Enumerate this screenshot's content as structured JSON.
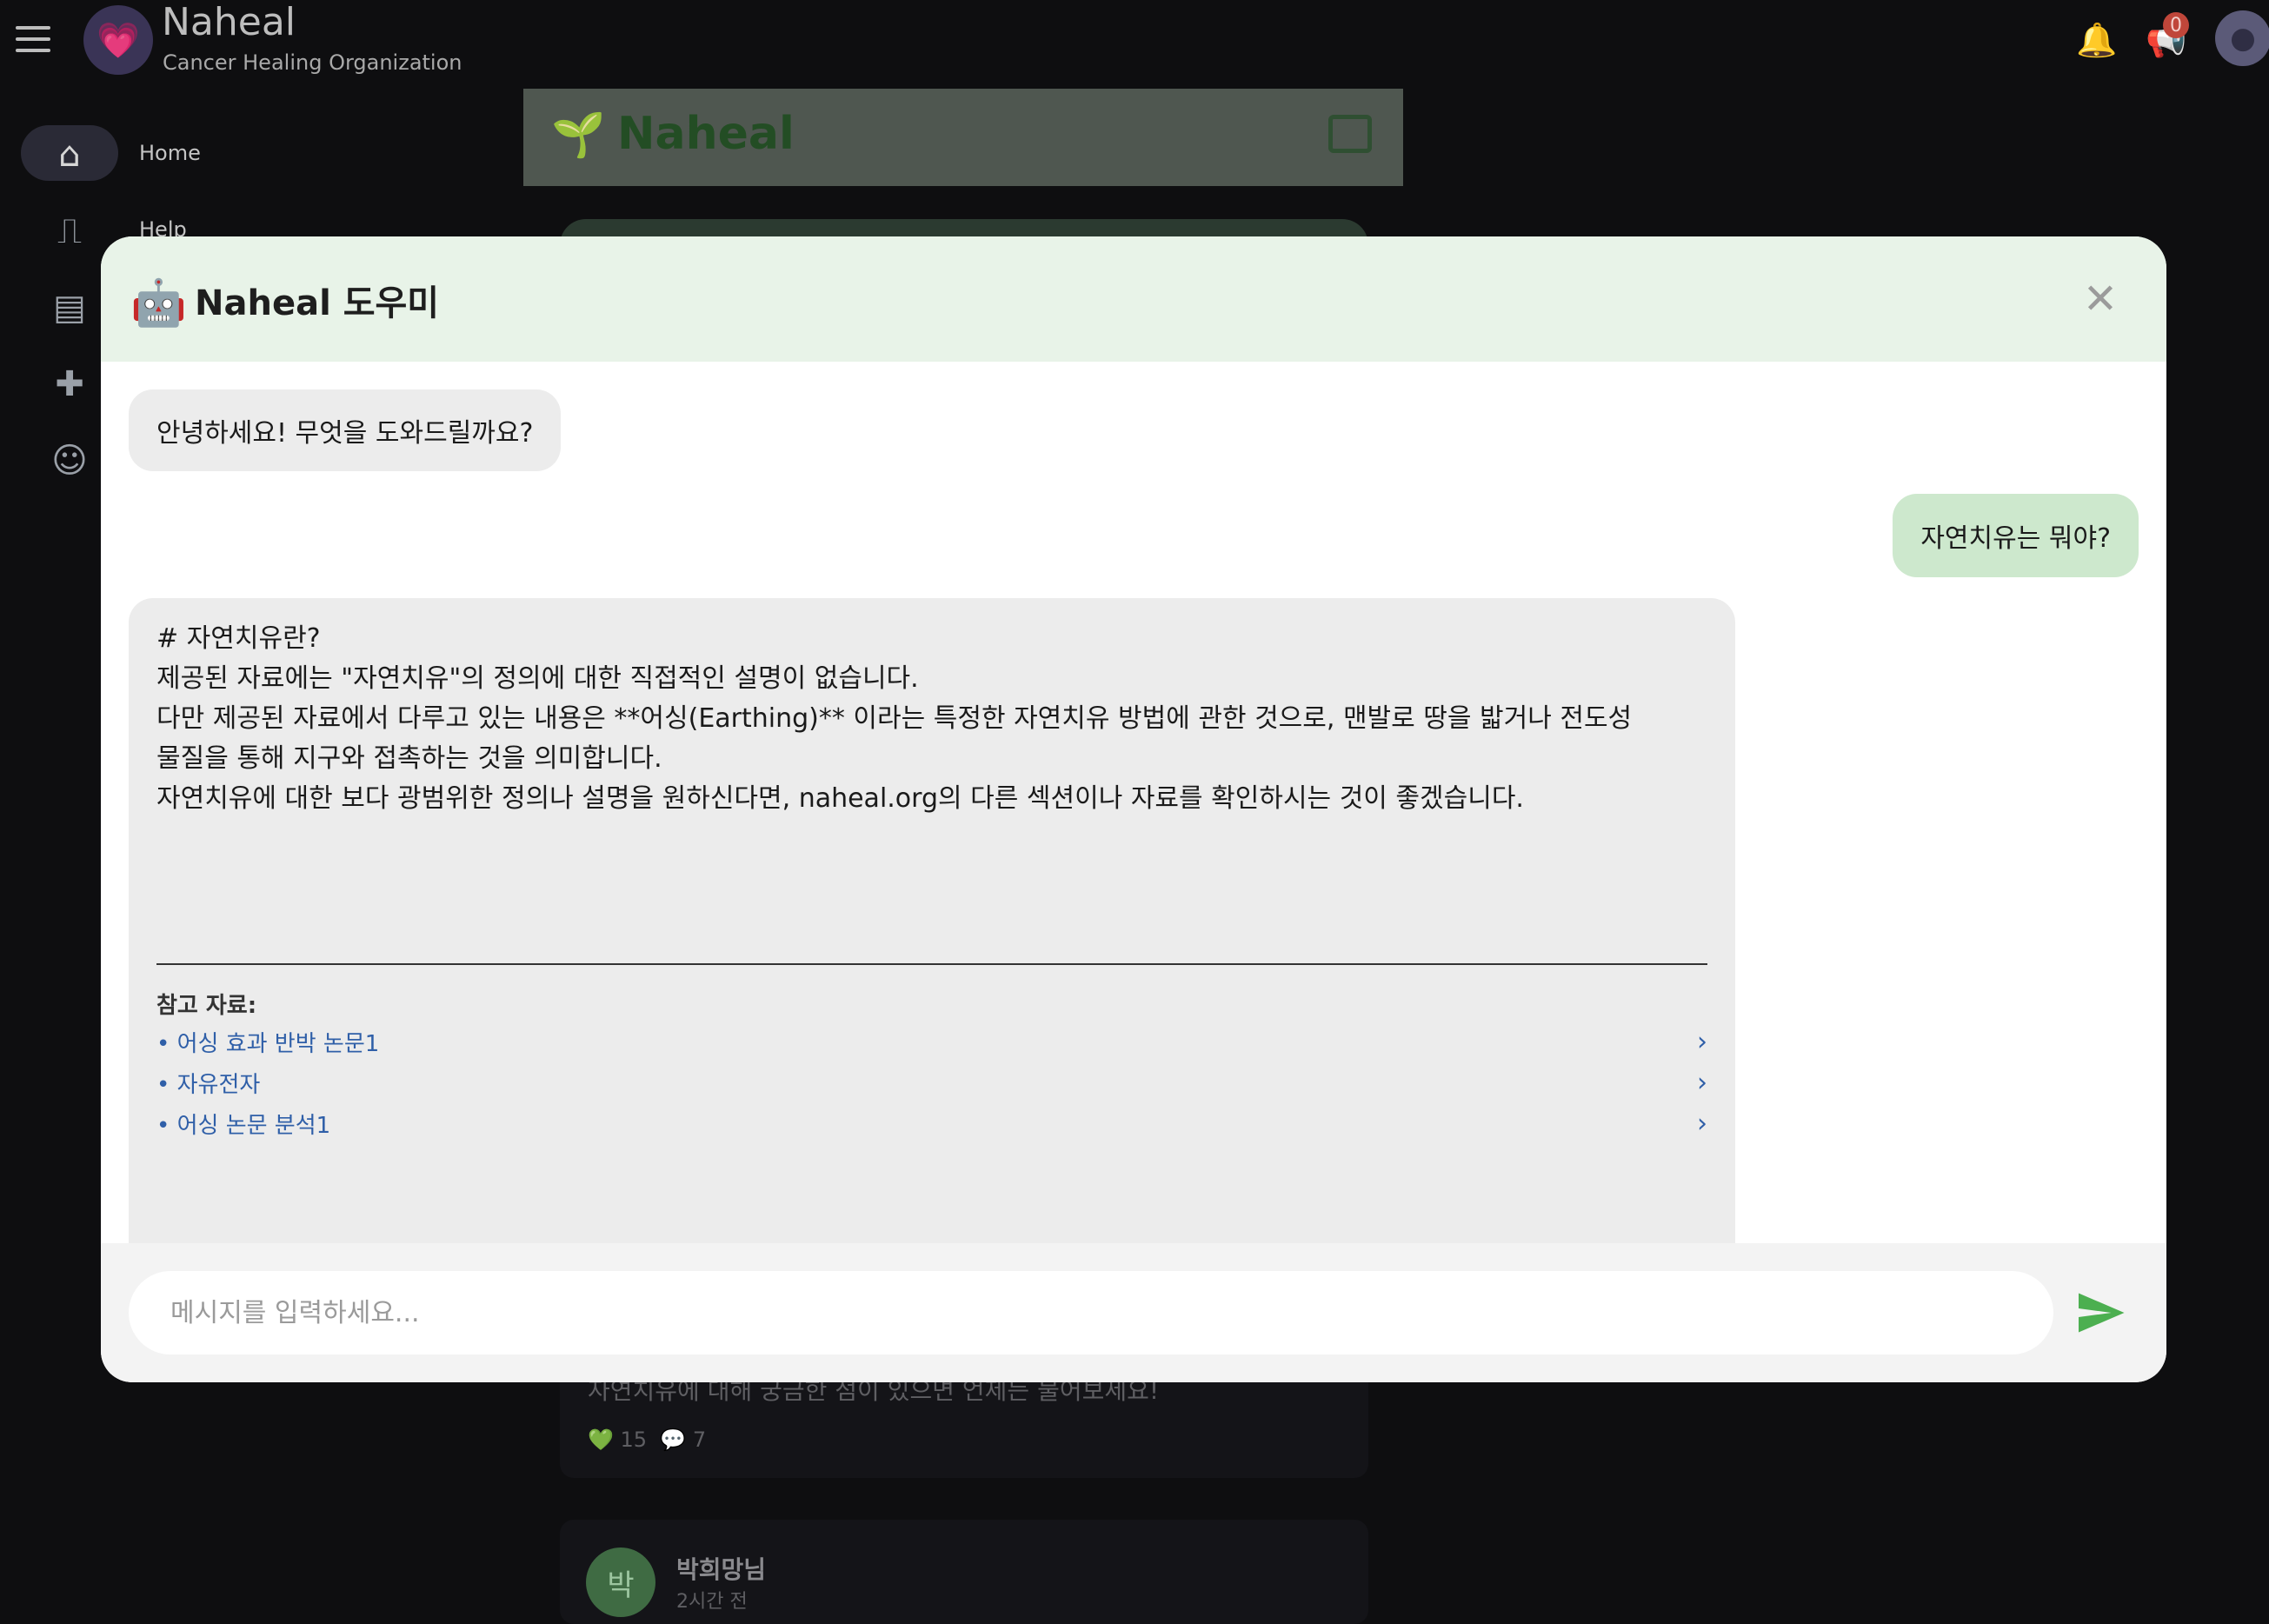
{
  "app": {
    "name": "Naheal",
    "subtitle": "Cancer Healing Organization",
    "notification_badge": "0"
  },
  "sidebar": {
    "items": [
      {
        "label": "Home",
        "icon": "home-icon"
      },
      {
        "label": "Help",
        "icon": "heartbeat-icon"
      },
      {
        "label": "",
        "icon": "store-icon"
      },
      {
        "label": "",
        "icon": "bandage-icon"
      },
      {
        "label": "",
        "icon": "person-icon"
      }
    ]
  },
  "feed": {
    "header_title": "Naheal",
    "post": {
      "text": "자연치유에 대해 궁금한 점이 있으면 언제든 물어보세요!",
      "likes": "15",
      "comments": "7"
    },
    "post2": {
      "avatar_initial": "박",
      "author": "박희망님",
      "time": "2시간 전"
    }
  },
  "chat": {
    "title": "Naheal 도우미",
    "messages": {
      "greeting": "안녕하세요! 무엇을 도와드릴까요?",
      "user_question": "자연치유는 뭐야?",
      "answer_lines": [
        "# 자연치유란?",
        "",
        "제공된 자료에는 \"자연치유\"의 정의에 대한 직접적인 설명이 없습니다.",
        "",
        "다만 제공된 자료에서 다루고 있는 내용은 **어싱(Earthing)** 이라는 특정한 자연치유 방법에 관한 것으로, 맨발로 땅을 밟거나 전도성",
        "물질을 통해 지구와 접촉하는 것을 의미합니다.",
        "",
        "자연치유에 대한 보다 광범위한 정의나 설명을 원하신다면, naheal.org의 다른 섹션이나 자료를 확인하시는 것이 좋겠습니다."
      ],
      "references_title": "참고 자료:",
      "references": [
        "• 어싱 효과 반박 논문1",
        "• 자유전자",
        "• 어싱 논문 분석1"
      ]
    },
    "input_placeholder": "메시지를 입력하세요..."
  },
  "colors": {
    "accent_green": "#4caf50",
    "header_bg": "#e8f3e8",
    "user_bubble": "#cde8cd",
    "link_blue": "#2f5fa8"
  }
}
